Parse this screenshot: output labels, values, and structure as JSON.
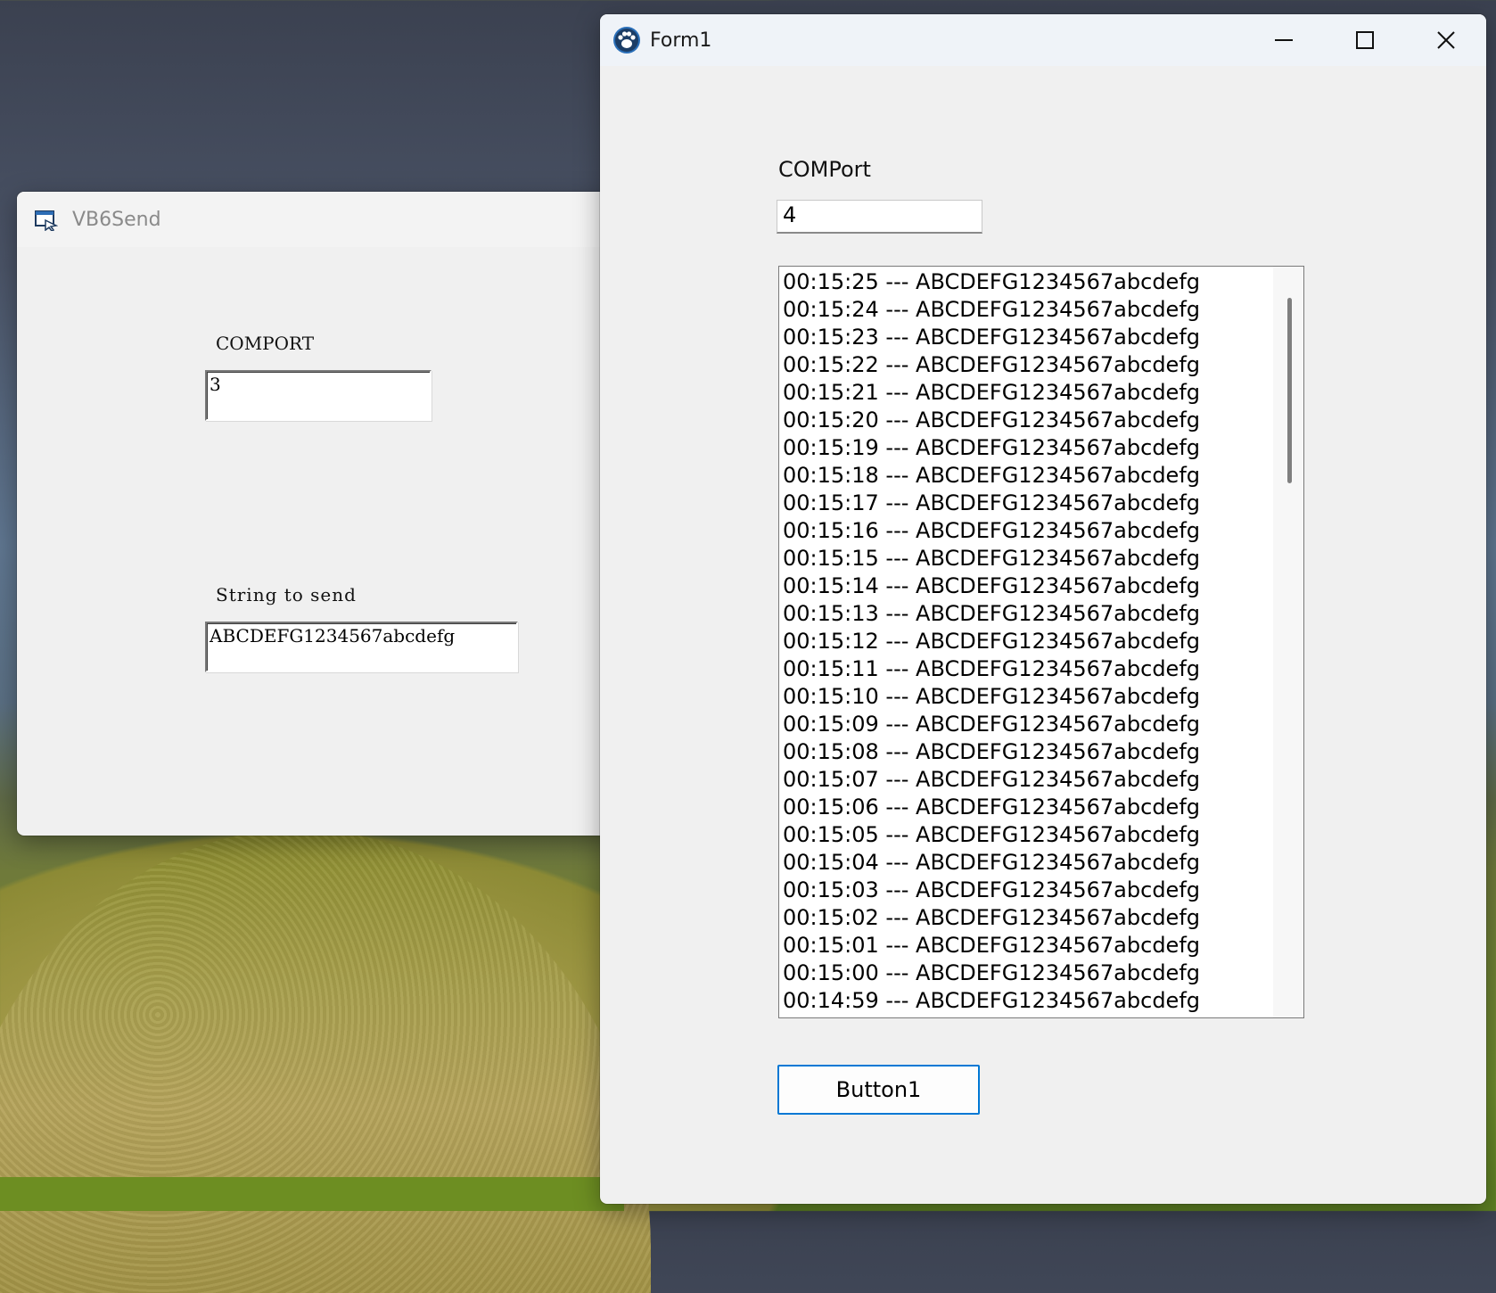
{
  "vb6send": {
    "title": "VB6Send",
    "comport_label": "COMPORT",
    "comport_value": "3",
    "string_label": "String to send",
    "string_value": "ABCDEFG1234567abcdefg"
  },
  "form1": {
    "title": "Form1",
    "comport_label": "COMPort",
    "comport_value": "4",
    "list_items": [
      "00:15:25 --- ABCDEFG1234567abcdefg",
      "00:15:24 --- ABCDEFG1234567abcdefg",
      "00:15:23 --- ABCDEFG1234567abcdefg",
      "00:15:22 --- ABCDEFG1234567abcdefg",
      "00:15:21 --- ABCDEFG1234567abcdefg",
      "00:15:20 --- ABCDEFG1234567abcdefg",
      "00:15:19 --- ABCDEFG1234567abcdefg",
      "00:15:18 --- ABCDEFG1234567abcdefg",
      "00:15:17 --- ABCDEFG1234567abcdefg",
      "00:15:16 --- ABCDEFG1234567abcdefg",
      "00:15:15 --- ABCDEFG1234567abcdefg",
      "00:15:14 --- ABCDEFG1234567abcdefg",
      "00:15:13 --- ABCDEFG1234567abcdefg",
      "00:15:12 --- ABCDEFG1234567abcdefg",
      "00:15:11 --- ABCDEFG1234567abcdefg",
      "00:15:10 --- ABCDEFG1234567abcdefg",
      "00:15:09 --- ABCDEFG1234567abcdefg",
      "00:15:08 --- ABCDEFG1234567abcdefg",
      "00:15:07 --- ABCDEFG1234567abcdefg",
      "00:15:06 --- ABCDEFG1234567abcdefg",
      "00:15:05 --- ABCDEFG1234567abcdefg",
      "00:15:04 --- ABCDEFG1234567abcdefg",
      "00:15:03 --- ABCDEFG1234567abcdefg",
      "00:15:02 --- ABCDEFG1234567abcdefg",
      "00:15:01 --- ABCDEFG1234567abcdefg",
      "00:15:00 --- ABCDEFG1234567abcdefg",
      "00:14:59 --- ABCDEFG1234567abcdefg"
    ],
    "button_label": "Button1",
    "caption_buttons": [
      "minimize",
      "maximize",
      "close"
    ]
  },
  "colors": {
    "accent_focus": "#0078d4",
    "window_bg": "#f0f0f0"
  }
}
